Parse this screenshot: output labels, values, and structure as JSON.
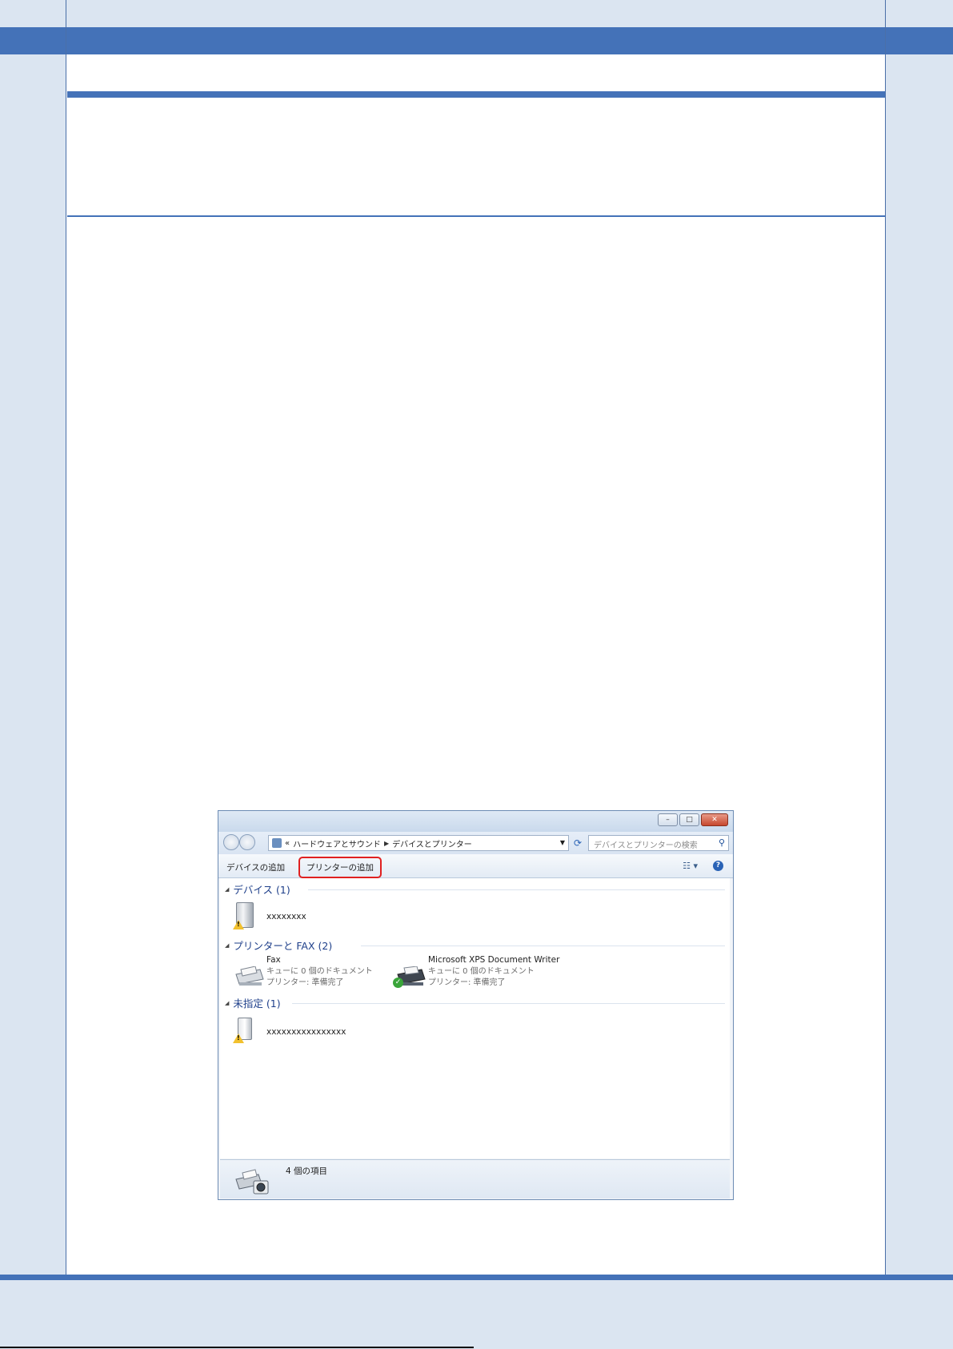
{
  "window": {
    "breadcrumb_prefix": "«",
    "breadcrumb": [
      "ハードウェアとサウンド",
      "デバイスとプリンター"
    ],
    "search_placeholder": "デバイスとプリンターの検索",
    "caption_buttons": {
      "minimize": "–",
      "maximize": "□",
      "close": "✕"
    }
  },
  "toolbar": {
    "add_device": "デバイスの追加",
    "add_printer": "プリンターの追加",
    "view_icon": "view-options-icon",
    "help_icon": "help-icon"
  },
  "groups": {
    "devices": {
      "header": "デバイス (1)",
      "items": [
        {
          "name": "xxxxxxxx",
          "icon": "computer-warning-icon"
        }
      ]
    },
    "printers": {
      "header": "プリンターと FAX (2)",
      "items": [
        {
          "name": "Fax",
          "queue": "キューに 0 個のドキュメント",
          "status": "プリンター: 準備完了",
          "icon": "fax-icon"
        },
        {
          "name": "Microsoft XPS Document Writer",
          "queue": "キューに 0 個のドキュメント",
          "status": "プリンター: 準備完了",
          "icon": "printer-default-icon"
        }
      ]
    },
    "unspecified": {
      "header": "未指定 (1)",
      "items": [
        {
          "name": "xxxxxxxxxxxxxxxx",
          "icon": "device-warning-icon"
        }
      ]
    }
  },
  "status_bar": {
    "count": "4 個の項目",
    "icon": "devices-printers-icon"
  },
  "colors": {
    "band": "#dbe5f1",
    "accent": "#4472b8",
    "highlight": "#e02020"
  }
}
